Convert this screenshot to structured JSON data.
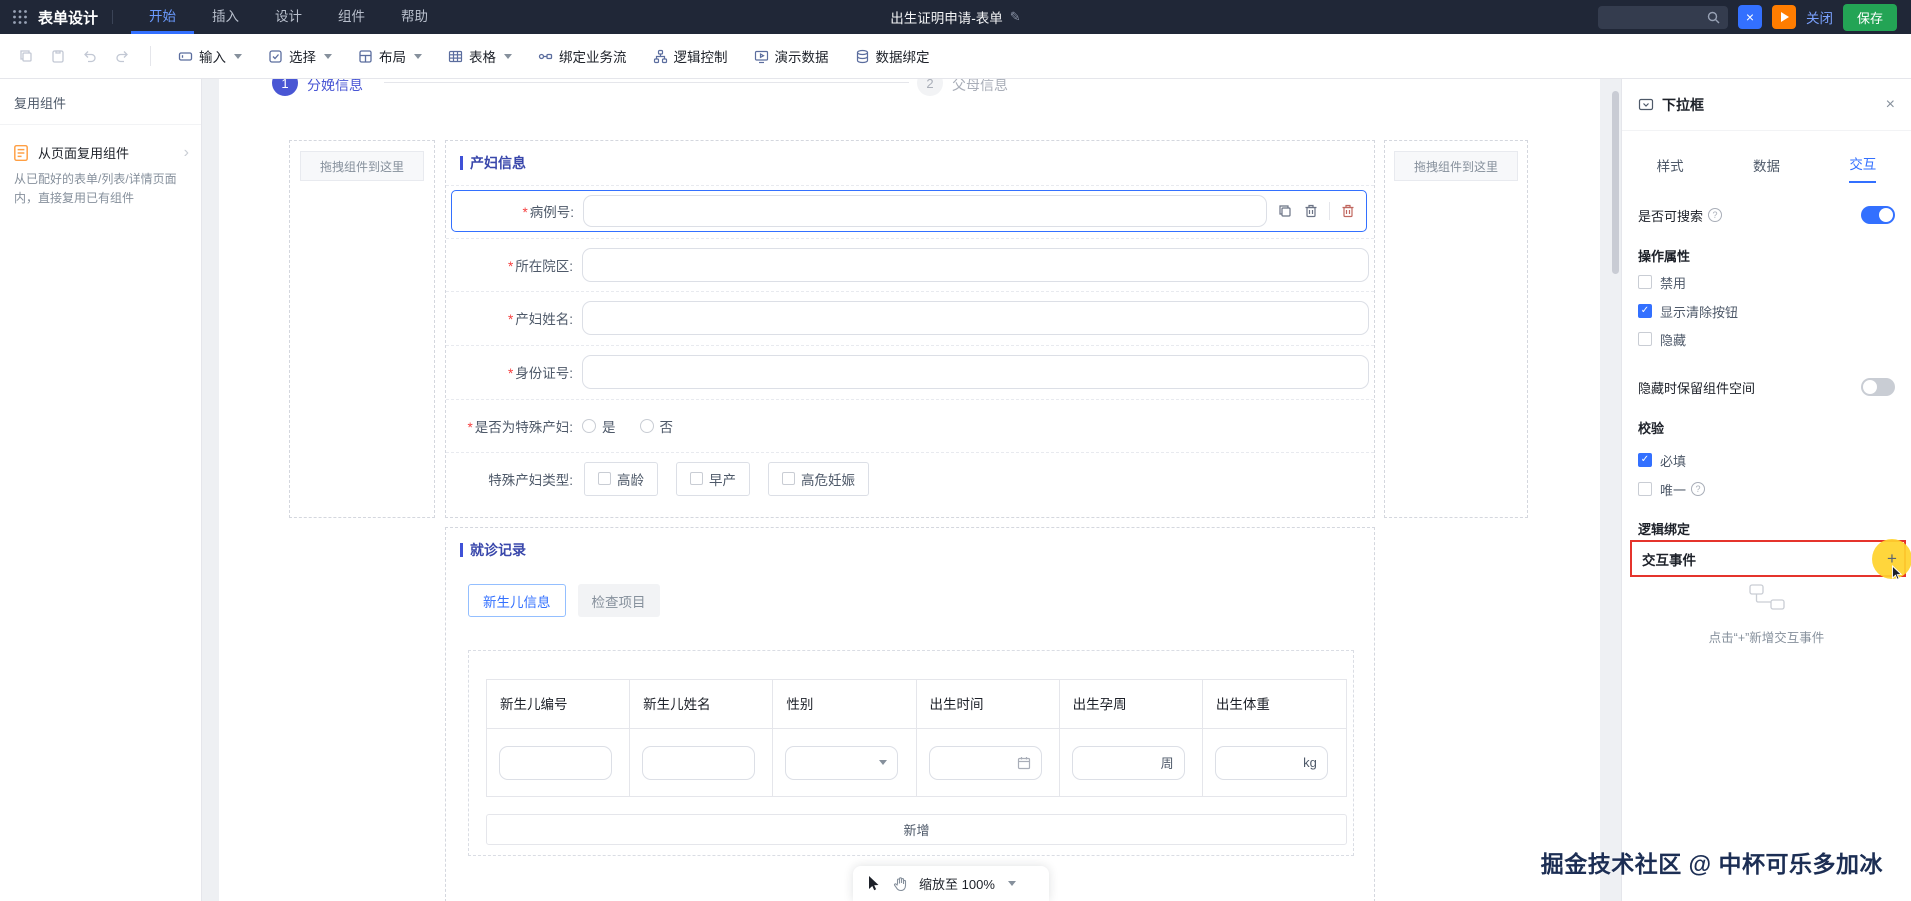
{
  "colors": {
    "accent": "#3370FF",
    "save_green": "#23A455",
    "run_orange": "#FF7D00",
    "annotation_red": "#E5342C",
    "highlight_yellow": "#FFD32E"
  },
  "topbar": {
    "app_title": "表单设计",
    "menus": [
      "开始",
      "插入",
      "设计",
      "组件",
      "帮助"
    ],
    "doc_title": "出生证明申请-表单",
    "close_label": "关闭",
    "save_label": "保存"
  },
  "toolbar": {
    "items": [
      {
        "label": "输入"
      },
      {
        "label": "选择"
      },
      {
        "label": "布局"
      },
      {
        "label": "表格"
      },
      {
        "label": "绑定业务流"
      },
      {
        "label": "逻辑控制"
      },
      {
        "label": "演示数据"
      },
      {
        "label": "数据绑定"
      }
    ]
  },
  "sidebar": {
    "title": "复用组件",
    "card_title": "从页面复用组件",
    "card_desc": "从已配好的表单/列表/详情页面内，直接复用已有组件"
  },
  "canvas": {
    "steps": [
      {
        "num": "1",
        "label": "分娩信息"
      },
      {
        "num": "2",
        "label": "父母信息"
      }
    ],
    "dropzone_label": "拖拽组件到这里",
    "required_mark": "*",
    "section1": {
      "title": "产妇信息",
      "fields": [
        {
          "label": "病例号:"
        },
        {
          "label": "所在院区:"
        },
        {
          "label": "产妇姓名:"
        },
        {
          "label": "身份证号:"
        }
      ],
      "radio_label": "是否为特殊产妇:",
      "radio_options": [
        "是",
        "否"
      ],
      "checkbox_label": "特殊产妇类型:",
      "checkbox_options": [
        "高龄",
        "早产",
        "高危妊娠"
      ]
    },
    "section2": {
      "title": "就诊记录",
      "tabs": [
        "新生儿信息",
        "检查项目"
      ],
      "headers": [
        "新生儿编号",
        "新生儿姓名",
        "性别",
        "出生时间",
        "出生孕周",
        "出生体重"
      ],
      "week_suffix": "周",
      "weight_suffix": "kg",
      "add_label": "新增"
    },
    "zoom_label": "缩放至",
    "zoom_value": "100%"
  },
  "panel": {
    "title": "下拉框",
    "tabs": [
      "样式",
      "数据",
      "交互"
    ],
    "searchable_label": "是否可搜索",
    "help_mark": "?",
    "op_section": "操作属性",
    "op_checks": [
      {
        "label": "禁用",
        "checked": false
      },
      {
        "label": "显示清除按钮",
        "checked": true
      },
      {
        "label": "隐藏",
        "checked": false
      }
    ],
    "keep_space_label": "隐藏时保留组件空间",
    "validate_section": "校验",
    "validate_checks": [
      {
        "label": "必填",
        "checked": true
      },
      {
        "label": "唯一",
        "checked": false
      }
    ],
    "logic_section": "逻辑绑定",
    "event_label": "交互事件",
    "plus_label": "+",
    "empty_hint": "点击“+”新增交互事件"
  },
  "watermark": "掘金技术社区 @ 中杯可乐多加冰"
}
